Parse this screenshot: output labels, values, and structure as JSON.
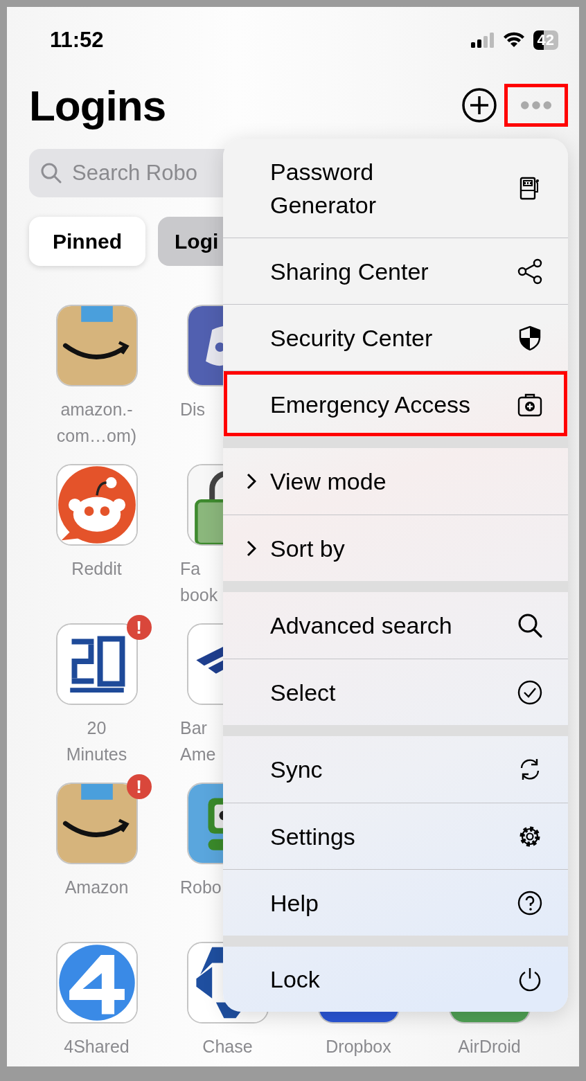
{
  "status_bar": {
    "time": "11:52",
    "battery": "42"
  },
  "header": {
    "title": "Logins",
    "more_highlighted": true
  },
  "search": {
    "placeholder": "Search Robo"
  },
  "filters": [
    {
      "label": "Pinned",
      "selected": true
    },
    {
      "label": "Logi",
      "selected": false
    }
  ],
  "app_rows": [
    [
      {
        "label": "amazon.-\ncom…om)"
      },
      {
        "label": "Dis"
      }
    ],
    [
      {
        "label": "Reddit"
      },
      {
        "label": "Fa\nbook"
      }
    ],
    [
      {
        "label": "20\nMinutes",
        "badge": "!"
      },
      {
        "label": "Bar\nAme"
      }
    ],
    [
      {
        "label": "Amazon",
        "badge": "!"
      },
      {
        "label": "Robo"
      }
    ],
    [
      {
        "label": "4Shared"
      },
      {
        "label": "Chase"
      },
      {
        "label": "Dropbox"
      },
      {
        "label": "AirDroid"
      }
    ]
  ],
  "menu": {
    "groups": [
      {
        "items": [
          {
            "label": "Password Generator",
            "kind": "action",
            "highlighted": false
          },
          {
            "label": "Sharing Center",
            "kind": "action",
            "highlighted": false
          },
          {
            "label": "Security Center",
            "kind": "action",
            "highlighted": false
          },
          {
            "label": "Emergency Access",
            "kind": "action",
            "highlighted": true
          }
        ]
      },
      {
        "items": [
          {
            "label": "View mode",
            "kind": "submenu",
            "highlighted": false
          },
          {
            "label": "Sort by",
            "kind": "submenu",
            "highlighted": false
          }
        ]
      },
      {
        "items": [
          {
            "label": "Advanced search",
            "kind": "action",
            "highlighted": false
          },
          {
            "label": "Select",
            "kind": "action",
            "highlighted": false
          }
        ]
      },
      {
        "items": [
          {
            "label": "Sync",
            "kind": "action",
            "highlighted": false
          },
          {
            "label": "Settings",
            "kind": "action",
            "highlighted": false
          },
          {
            "label": "Help",
            "kind": "action",
            "highlighted": false
          }
        ]
      },
      {
        "items": [
          {
            "label": "Lock",
            "kind": "action",
            "highlighted": false
          }
        ]
      }
    ]
  }
}
